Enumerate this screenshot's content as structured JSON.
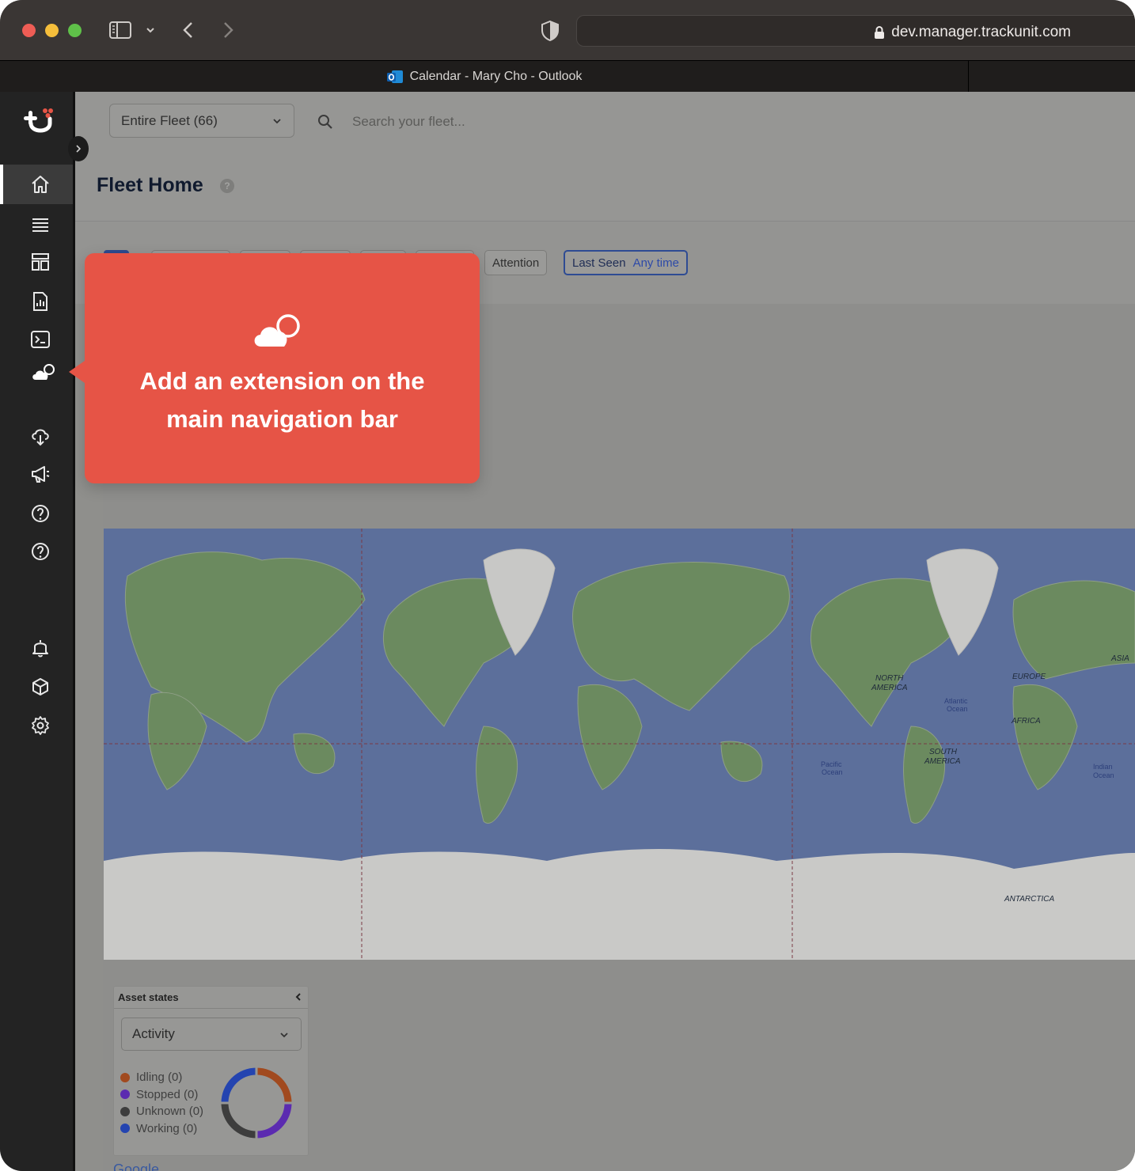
{
  "browser": {
    "url": "dev.manager.trackunit.com",
    "tab_title": "Calendar - Mary Cho - Outlook"
  },
  "toolbar": {
    "fleet_selector": "Entire Fleet (66)",
    "search_placeholder": "Search your fleet..."
  },
  "page": {
    "title": "Fleet Home",
    "help": "?"
  },
  "filters": {
    "attention": "Attention",
    "last_seen_label": "Last Seen",
    "last_seen_value": "Any time"
  },
  "callout": {
    "line1": "Add an extension on the",
    "line2": "main navigation bar"
  },
  "map_labels": {
    "north_america": "NORTH",
    "north_america_2": "AMERICA",
    "europe": "EUROPE",
    "asia": "ASIA",
    "africa": "AFRICA",
    "south_america": "SOUTH",
    "south_america_2": "AMERICA",
    "atlantic": "Atlantic",
    "atlantic_2": "Ocean",
    "pacific": "Pacific",
    "pacific_2": "Ocean",
    "indian": "Indian",
    "indian_2": "Ocean",
    "antarctica": "ANTARCTICA"
  },
  "asset_states": {
    "title": "Asset states",
    "selected_view": "Activity",
    "legend": [
      {
        "label": "Idling (0)",
        "color": "#a14a1f"
      },
      {
        "label": "Stopped (0)",
        "color": "#5b2bb0"
      },
      {
        "label": "Unknown (0)",
        "color": "#3d3d3d"
      },
      {
        "label": "Working (0)",
        "color": "#2444b0"
      }
    ]
  },
  "footer": {
    "map_brand": "Google"
  },
  "colors": {
    "nav_bg": "#232323",
    "callout": "#e65446",
    "map_water": "#5c6f9b"
  }
}
